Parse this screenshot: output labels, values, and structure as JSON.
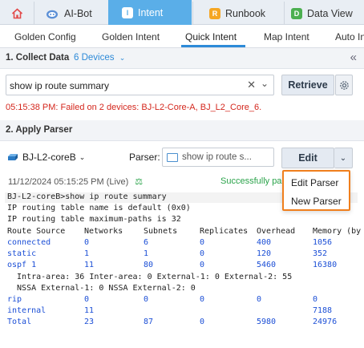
{
  "tabs": {
    "home_icon": "home-icon",
    "aibot": "AI-Bot",
    "intent_icon_letter": "I",
    "intent": "Intent",
    "runbook_icon_letter": "R",
    "runbook": "Runbook",
    "dataview_icon_letter": "D",
    "dataview": "Data View",
    "colors": {
      "active_tab_bg": "#5aaee8",
      "runbook_icon": "#f5a623",
      "dataview_icon": "#4caf50"
    }
  },
  "subtabs": [
    "Golden Config",
    "Golden Intent",
    "Quick Intent",
    "Map Intent",
    "Auto In"
  ],
  "subtab_active": "Quick Intent",
  "collect": {
    "title": "1. Collect Data",
    "devices_link": "6 Devices",
    "command": "show ip route summary",
    "retrieve_label": "Retrieve",
    "error": "05:15:38 PM: Failed on 2 devices: BJ-L2-Core-A, BJ_L2_Core_6."
  },
  "apply": {
    "title": "2. Apply Parser",
    "device": "BJ-L2-coreB",
    "parser_label": "Parser:",
    "parser_value": "show ip route s...",
    "edit_label": "Edit",
    "timestamp": "11/12/2024 05:15:25 PM (Live)",
    "success": "Successfully pa",
    "menu": [
      "Edit Parser",
      "New Parser"
    ]
  },
  "output": {
    "prompt": "BJ-L2-coreB>",
    "command": "show ip route summary",
    "lines": [
      "IP routing table name is default (0x0)",
      "IP routing table maximum-paths is 32"
    ],
    "headers": [
      "Route Source",
      "Networks",
      "Subnets",
      "Replicates",
      "Overhead",
      "Memory (by"
    ],
    "rows": [
      {
        "name": "connected",
        "cells": [
          "0",
          "6",
          "0",
          "400",
          "1056"
        ]
      },
      {
        "name": "static",
        "cells": [
          "1",
          "1",
          "0",
          "120",
          "352"
        ]
      },
      {
        "name": "ospf 1",
        "cells": [
          "11",
          "80",
          "0",
          "5460",
          "16380"
        ]
      }
    ],
    "ospf_detail": [
      "  Intra-area: 36 Inter-area: 0 External-1: 0 External-2: 55",
      "  NSSA External-1: 0 NSSA External-2: 0"
    ],
    "rows2": [
      {
        "name": "rip",
        "cells": [
          "0",
          "0",
          "0",
          "0",
          "0"
        ]
      },
      {
        "name": "internal",
        "cells": [
          "11",
          "",
          "",
          "",
          "7188"
        ]
      },
      {
        "name": "Total",
        "cells": [
          "23",
          "87",
          "0",
          "5980",
          "24976"
        ]
      }
    ]
  }
}
